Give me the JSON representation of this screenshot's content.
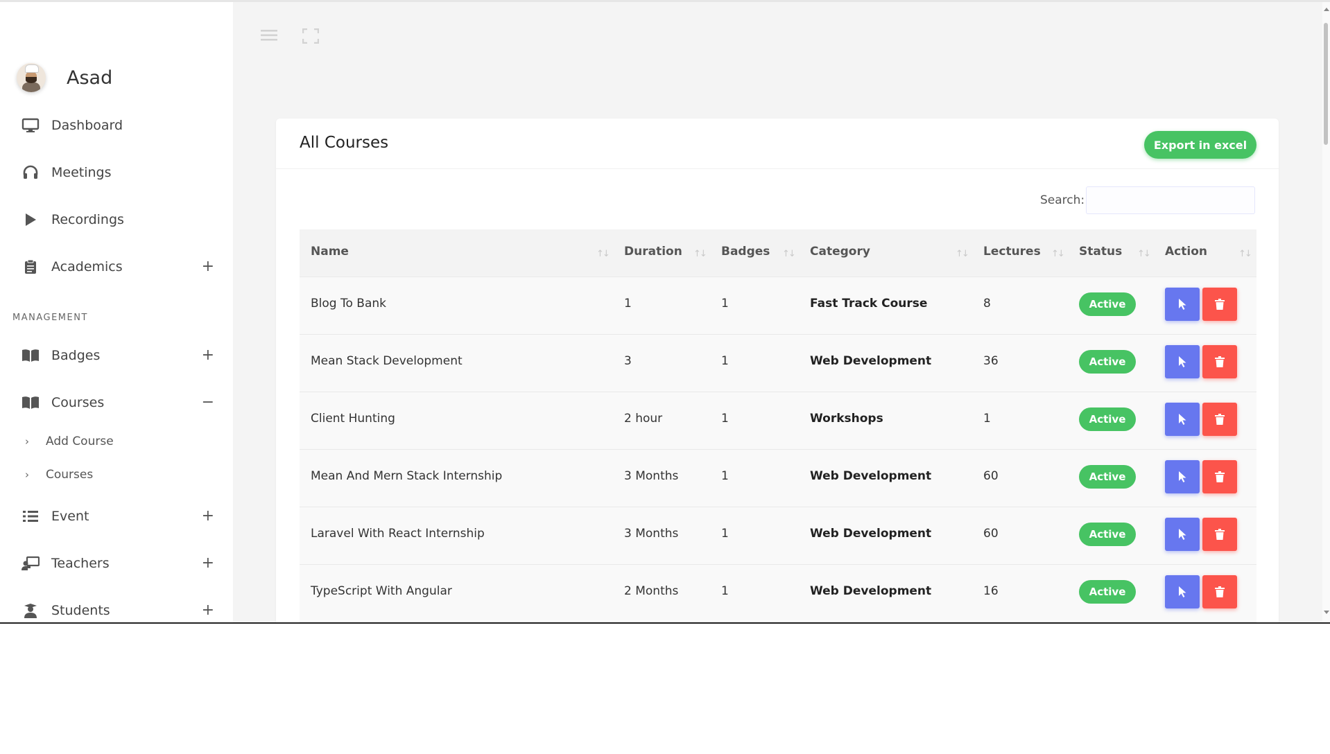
{
  "profile": {
    "name": "Asad"
  },
  "sidebar": {
    "nav": [
      {
        "label": "Dashboard",
        "icon": "monitor-icon"
      },
      {
        "label": "Meetings",
        "icon": "headphones-icon"
      },
      {
        "label": "Recordings",
        "icon": "play-icon"
      },
      {
        "label": "Academics",
        "icon": "clipboard-icon",
        "toggle": "+"
      }
    ],
    "section_title": "MANAGEMENT",
    "management": [
      {
        "label": "Badges",
        "icon": "book-icon",
        "toggle": "+"
      },
      {
        "label": "Courses",
        "icon": "book-icon",
        "toggle": "−"
      },
      {
        "label": "Event",
        "icon": "list-icon",
        "toggle": "+"
      },
      {
        "label": "Teachers",
        "icon": "chalkboard-teacher-icon",
        "toggle": "+"
      },
      {
        "label": "Students",
        "icon": "user-graduate-icon",
        "toggle": "+"
      }
    ],
    "courses_sub": [
      {
        "label": "Add Course"
      },
      {
        "label": "Courses"
      }
    ]
  },
  "card": {
    "title": "All Courses",
    "export_label": "Export in excel",
    "search_label": "Search:",
    "search_value": ""
  },
  "table": {
    "columns": [
      "Name",
      "Duration",
      "Badges",
      "Category",
      "Lectures",
      "Status",
      "Action"
    ],
    "rows": [
      {
        "name": "Blog To Bank",
        "duration": "1",
        "badges": "1",
        "category": "Fast Track Course",
        "lectures": "8",
        "status": "Active"
      },
      {
        "name": "Mean Stack Development",
        "duration": "3",
        "badges": "1",
        "category": "Web Development",
        "lectures": "36",
        "status": "Active"
      },
      {
        "name": "Client Hunting",
        "duration": "2 hour",
        "badges": "1",
        "category": "Workshops",
        "lectures": "1",
        "status": "Active"
      },
      {
        "name": "Mean And Mern Stack Internship",
        "duration": "3 Months",
        "badges": "1",
        "category": "Web Development",
        "lectures": "60",
        "status": "Active"
      },
      {
        "name": "Laravel With React Internship",
        "duration": "3 Months",
        "badges": "1",
        "category": "Web Development",
        "lectures": "60",
        "status": "Active"
      },
      {
        "name": "TypeScript With Angular",
        "duration": "2 Months",
        "badges": "1",
        "category": "Web Development",
        "lectures": "16",
        "status": "Active"
      }
    ]
  },
  "colors": {
    "success": "#47c363",
    "primary": "#6777ef",
    "danger": "#fc544b"
  }
}
